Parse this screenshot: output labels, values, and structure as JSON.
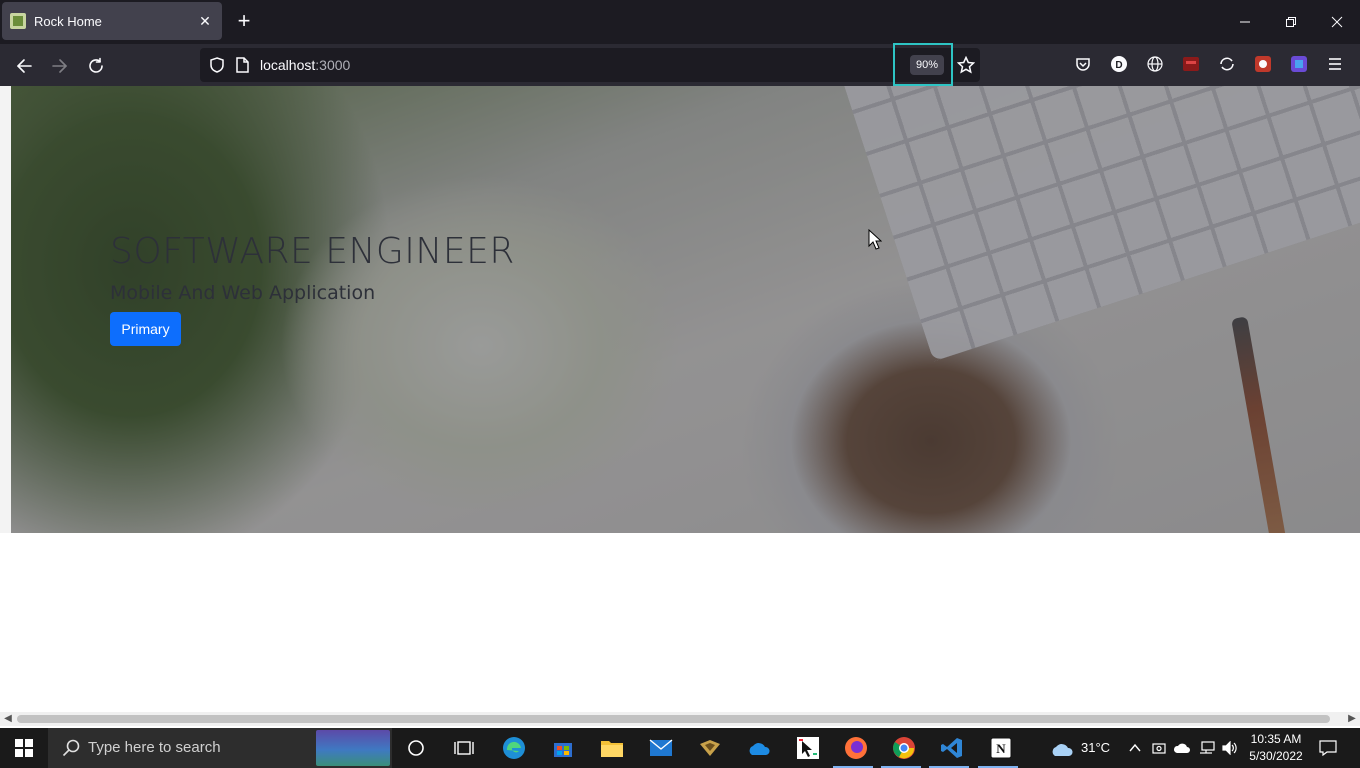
{
  "browser": {
    "tab_title": "Rock Home",
    "url_host": "localhost",
    "url_port": ":3000",
    "zoom_level": "90%",
    "accent_color": "#2ec4c4"
  },
  "hero": {
    "title": "SOFTWARE ENGINEER",
    "subtitle": "Mobile And Web Application",
    "button_label": "Primary",
    "button_color": "#0d6efd"
  },
  "taskbar": {
    "search_placeholder": "Type here to search",
    "weather_temp": "31°C",
    "clock_time": "10:35 AM",
    "clock_date": "5/30/2022",
    "pinned_apps": [
      "cortana",
      "task-view",
      "edge",
      "store",
      "file-explorer",
      "mail",
      "app",
      "onedrive",
      "snipping-tool",
      "firefox",
      "chrome",
      "vscode",
      "notion"
    ]
  }
}
